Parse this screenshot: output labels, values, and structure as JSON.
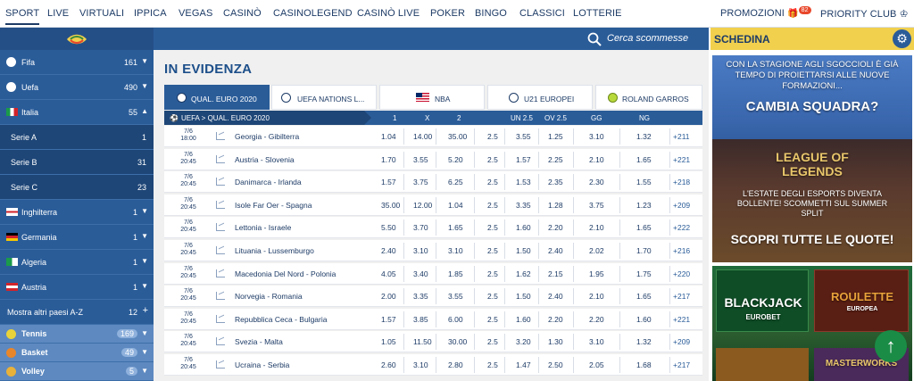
{
  "nav": {
    "items": [
      "SPORT",
      "LIVE",
      "VIRTUALI",
      "IPPICA",
      "VEGAS",
      "CASINÒ",
      "CASINOLEGEND",
      "CASINÒ LIVE",
      "POKER",
      "BINGO",
      "CLASSICI",
      "LOTTERIE"
    ],
    "promozioni": "PROMOZIONI",
    "promo_badge": "82",
    "priority": "PRIORITY CLUB"
  },
  "sidebar": {
    "rows": [
      {
        "label": "Fifa",
        "count": "161"
      },
      {
        "label": "Uefa",
        "count": "490"
      },
      {
        "label": "Italia",
        "count": "55"
      },
      {
        "label": "Serie A",
        "count": "1"
      },
      {
        "label": "Serie B",
        "count": "31"
      },
      {
        "label": "Serie C",
        "count": "23"
      },
      {
        "label": "Inghilterra",
        "count": "1"
      },
      {
        "label": "Germania",
        "count": "1"
      },
      {
        "label": "Algeria",
        "count": "1"
      },
      {
        "label": "Austria",
        "count": "1"
      },
      {
        "label": "Mostra altri paesi A-Z",
        "count": "12"
      },
      {
        "label": "Tennis",
        "count": "169"
      },
      {
        "label": "Basket",
        "count": "49"
      },
      {
        "label": "Volley",
        "count": "5"
      }
    ]
  },
  "search": {
    "label": "Cerca scommesse"
  },
  "main": {
    "title": "IN EVIDENZA",
    "tabs": [
      "QUAL. EURO 2020",
      "UEFA NATIONS L...",
      "NBA",
      "U21 EUROPEI",
      "ROLAND GARROS"
    ],
    "breadcrumb": "UEFA > QUAL. EURO 2020",
    "headers": [
      "1",
      "X",
      "2",
      "UN 2.5",
      "OV 2.5",
      "GG",
      "NG"
    ],
    "rows": [
      {
        "d": "7/6",
        "t": "18:00",
        "match": "Georgia - Gibilterra",
        "o1": "1.04",
        "ox": "14.00",
        "o2": "35.00",
        "line": "2.5",
        "un": "3.55",
        "ov": "1.25",
        "gg": "3.10",
        "ng": "1.32",
        "more": "+211"
      },
      {
        "d": "7/6",
        "t": "20:45",
        "match": "Austria - Slovenia",
        "o1": "1.70",
        "ox": "3.55",
        "o2": "5.20",
        "line": "2.5",
        "un": "1.57",
        "ov": "2.25",
        "gg": "2.10",
        "ng": "1.65",
        "more": "+221"
      },
      {
        "d": "7/6",
        "t": "20:45",
        "match": "Danimarca - Irlanda",
        "o1": "1.57",
        "ox": "3.75",
        "o2": "6.25",
        "line": "2.5",
        "un": "1.53",
        "ov": "2.35",
        "gg": "2.30",
        "ng": "1.55",
        "more": "+218"
      },
      {
        "d": "7/6",
        "t": "20:45",
        "match": "Isole Far Oer - Spagna",
        "o1": "35.00",
        "ox": "12.00",
        "o2": "1.04",
        "line": "2.5",
        "un": "3.35",
        "ov": "1.28",
        "gg": "3.75",
        "ng": "1.23",
        "more": "+209"
      },
      {
        "d": "7/6",
        "t": "20:45",
        "match": "Lettonia - Israele",
        "o1": "5.50",
        "ox": "3.70",
        "o2": "1.65",
        "line": "2.5",
        "un": "1.60",
        "ov": "2.20",
        "gg": "2.10",
        "ng": "1.65",
        "more": "+222"
      },
      {
        "d": "7/6",
        "t": "20:45",
        "match": "Lituania - Lussemburgo",
        "o1": "2.40",
        "ox": "3.10",
        "o2": "3.10",
        "line": "2.5",
        "un": "1.50",
        "ov": "2.40",
        "gg": "2.02",
        "ng": "1.70",
        "more": "+216"
      },
      {
        "d": "7/6",
        "t": "20:45",
        "match": "Macedonia Del Nord - Polonia",
        "o1": "4.05",
        "ox": "3.40",
        "o2": "1.85",
        "line": "2.5",
        "un": "1.62",
        "ov": "2.15",
        "gg": "1.95",
        "ng": "1.75",
        "more": "+220"
      },
      {
        "d": "7/6",
        "t": "20:45",
        "match": "Norvegia - Romania",
        "o1": "2.00",
        "ox": "3.35",
        "o2": "3.55",
        "line": "2.5",
        "un": "1.50",
        "ov": "2.40",
        "gg": "2.10",
        "ng": "1.65",
        "more": "+217"
      },
      {
        "d": "7/6",
        "t": "20:45",
        "match": "Repubblica Ceca - Bulgaria",
        "o1": "1.57",
        "ox": "3.85",
        "o2": "6.00",
        "line": "2.5",
        "un": "1.60",
        "ov": "2.20",
        "gg": "2.20",
        "ng": "1.60",
        "more": "+221"
      },
      {
        "d": "7/6",
        "t": "20:45",
        "match": "Svezia - Malta",
        "o1": "1.05",
        "ox": "11.50",
        "o2": "30.00",
        "line": "2.5",
        "un": "3.20",
        "ov": "1.30",
        "gg": "3.10",
        "ng": "1.32",
        "more": "+209"
      },
      {
        "d": "7/6",
        "t": "20:45",
        "match": "Ucraina - Serbia",
        "o1": "2.60",
        "ox": "3.10",
        "o2": "2.80",
        "line": "2.5",
        "un": "1.47",
        "ov": "2.50",
        "gg": "2.05",
        "ng": "1.68",
        "more": "+217"
      }
    ]
  },
  "right": {
    "schedina": "SCHEDINA",
    "banner1_text": "CON LA STAGIONE AGLI SGOCCIOLI È GIÀ TEMPO DI PROIETTARSI ALLE NUOVE FORMAZIONI...",
    "banner1_cta": "CAMBIA SQUADRA?",
    "banner2_logo": "LEAGUE OF LEGENDS",
    "banner2_text": "L'ESTATE DEGLI ESPORTS DIVENTA BOLLENTE! SCOMMETTI SUL SUMMER SPLIT",
    "banner2_cta": "SCOPRI TUTTE LE QUOTE!",
    "game1_title": "BLACKJACK",
    "game1_sub": "EUROBET",
    "game2_title": "ROULETTE",
    "game2_sub": "EUROPEA",
    "game3_title": "MASTERWORKS"
  },
  "colors": {
    "primary": "#2a5c98",
    "dark": "#1e4677",
    "accent_yellow": "#f1d04e",
    "go_top": "#1a8c46"
  }
}
